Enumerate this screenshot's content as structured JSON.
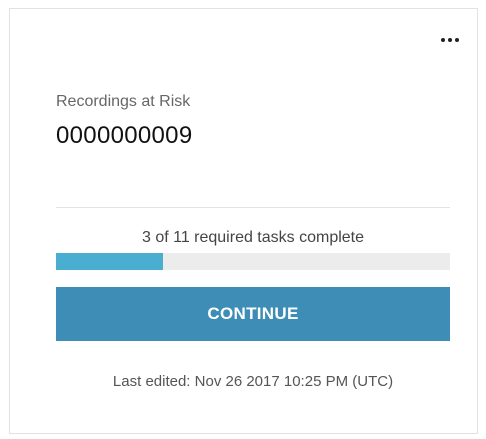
{
  "card": {
    "menu_icon": "more-horizontal-icon",
    "metric_label": "Recordings at Risk",
    "metric_value": "0000000009",
    "progress": {
      "text": "3 of 11 required tasks complete",
      "completed": 3,
      "total": 11,
      "fill_color": "#4aaed0",
      "track_color": "#ececec"
    },
    "continue_label": "CONTINUE",
    "button_color": "#3d8db6",
    "last_edited": "Last edited: Nov 26 2017 10:25 PM (UTC)"
  }
}
